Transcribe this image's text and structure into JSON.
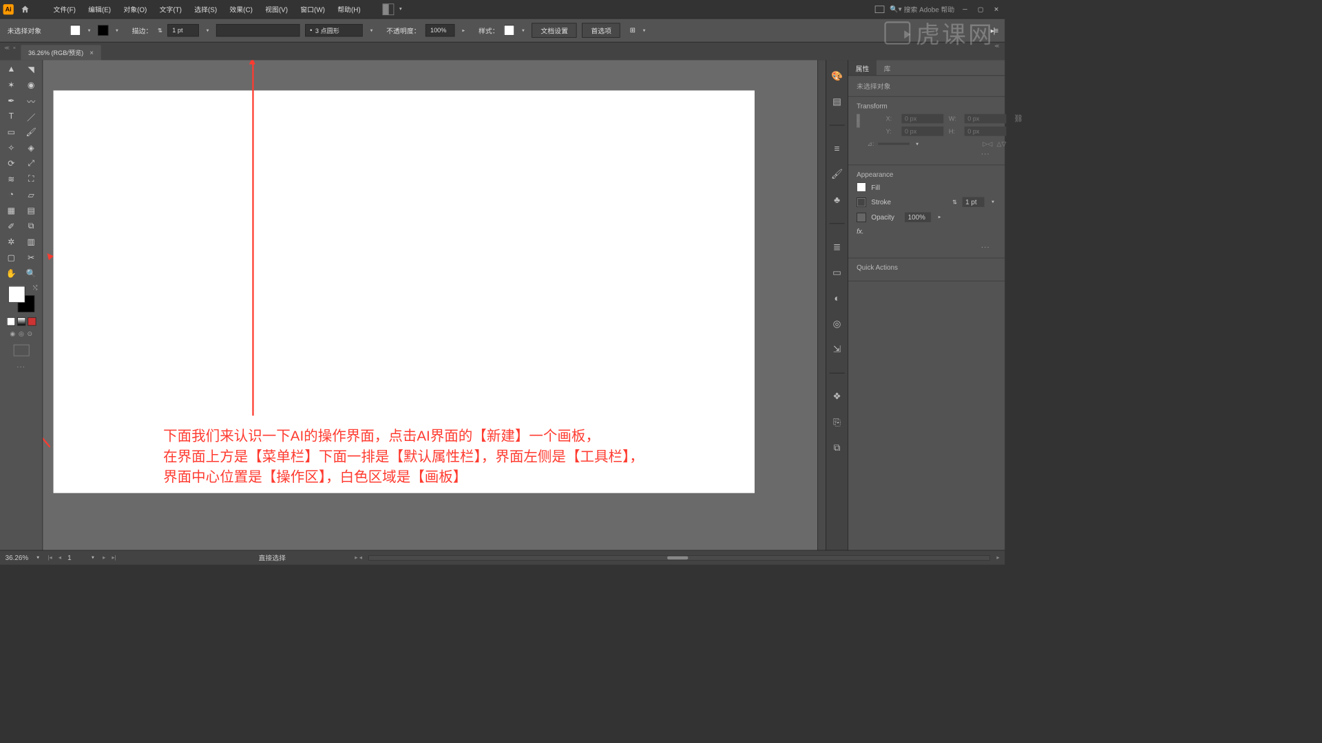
{
  "app_logo_text": "Ai",
  "menu": {
    "items": [
      "文件(F)",
      "编辑(E)",
      "对象(O)",
      "文字(T)",
      "选择(S)",
      "效果(C)",
      "视图(V)",
      "窗口(W)",
      "帮助(H)"
    ],
    "search_placeholder": "搜索 Adobe 帮助"
  },
  "options": {
    "status": "未选择对象",
    "stroke_label": "描边：",
    "stroke_value": "1 pt",
    "brush_value": "3 点圆形",
    "opacity_label": "不透明度：",
    "opacity_value": "100%",
    "style_label": "样式：",
    "btn_doc_setup": "文档设置",
    "btn_prefs": "首选项"
  },
  "doc_tab": {
    "label": "36.26% (RGB/预览)",
    "close": "×"
  },
  "canvas_annotation": {
    "line1": "下面我们来认识一下AI的操作界面，点击AI界面的【新建】一个画板，",
    "line2": "在界面上方是【菜单栏】下面一排是【默认属性栏】，界面左侧是【工具栏】，",
    "line3": "界面中心位置是【操作区】，白色区域是【画板】"
  },
  "right_panel": {
    "tab_properties": "属性",
    "tab_library": "库",
    "status": "未选择对象",
    "transform_title": "Transform",
    "transform": {
      "x_label": "X:",
      "x_val": "0 px",
      "y_label": "Y:",
      "y_val": "0 px",
      "w_label": "W:",
      "w_val": "0 px",
      "h_label": "H:",
      "h_val": "0 px",
      "angle_label": "⊿:"
    },
    "appearance_title": "Appearance",
    "fill_label": "Fill",
    "stroke_label": "Stroke",
    "stroke_val": "1 pt",
    "opacity_label": "Opacity",
    "opacity_val": "100%",
    "fx_label": "fx.",
    "quick_actions": "Quick Actions"
  },
  "status_bar": {
    "zoom": "36.26%",
    "page": "1",
    "tool_name": "直接选择"
  },
  "watermark_text": "虎课网"
}
